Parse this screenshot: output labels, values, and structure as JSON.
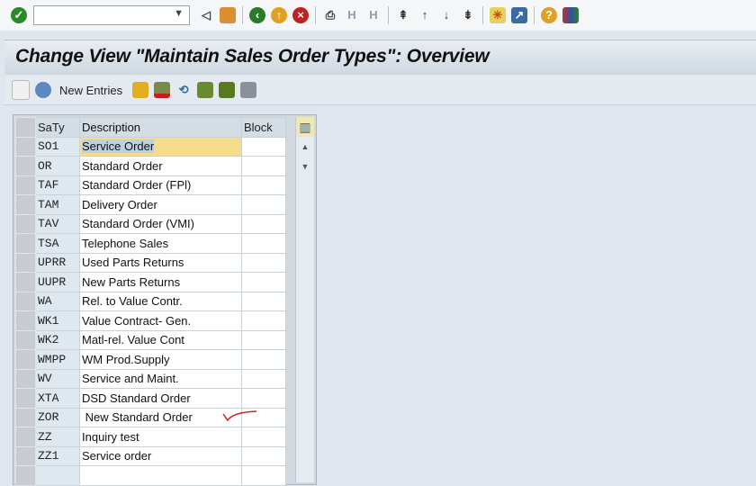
{
  "toolbar": {
    "command_field": "",
    "icons": [
      "enter-icon",
      "back-icon",
      "save-icon",
      "back-green-icon",
      "exit-icon",
      "cancel-icon",
      "print-icon",
      "find-icon",
      "find-next-icon",
      "first-page-icon",
      "prev-page-icon",
      "next-page-icon",
      "last-page-icon",
      "new-session-icon",
      "shortcut-icon",
      "help-icon",
      "customize-layout-icon"
    ]
  },
  "title": "Change View \"Maintain Sales Order Types\": Overview",
  "app_toolbar": {
    "new_entries": "New Entries"
  },
  "table": {
    "headers": [
      "SaTy",
      "Description",
      "Block"
    ],
    "rows": [
      {
        "key": "SO1",
        "desc": "Service Order"
      },
      {
        "key": "OR",
        "desc": "Standard Order"
      },
      {
        "key": "TAF",
        "desc": "Standard Order (FPl)"
      },
      {
        "key": "TAM",
        "desc": "Delivery Order"
      },
      {
        "key": "TAV",
        "desc": "Standard Order (VMI)"
      },
      {
        "key": "TSA",
        "desc": "Telephone Sales"
      },
      {
        "key": "UPRR",
        "desc": "Used Parts Returns"
      },
      {
        "key": "UUPR",
        "desc": "New Parts Returns"
      },
      {
        "key": "WA",
        "desc": "Rel. to Value Contr."
      },
      {
        "key": "WK1",
        "desc": "Value Contract- Gen."
      },
      {
        "key": "WK2",
        "desc": "Matl-rel. Value Cont"
      },
      {
        "key": "WMPP",
        "desc": "WM Prod.Supply"
      },
      {
        "key": "WV",
        "desc": "Service and Maint."
      },
      {
        "key": "XTA",
        "desc": "DSD Standard Order"
      },
      {
        "key": "ZOR",
        "desc": " New Standard Order"
      },
      {
        "key": "ZZ",
        "desc": "Inquiry test"
      },
      {
        "key": "ZZ1",
        "desc": "Service order"
      },
      {
        "key": "",
        "desc": ""
      }
    ]
  }
}
